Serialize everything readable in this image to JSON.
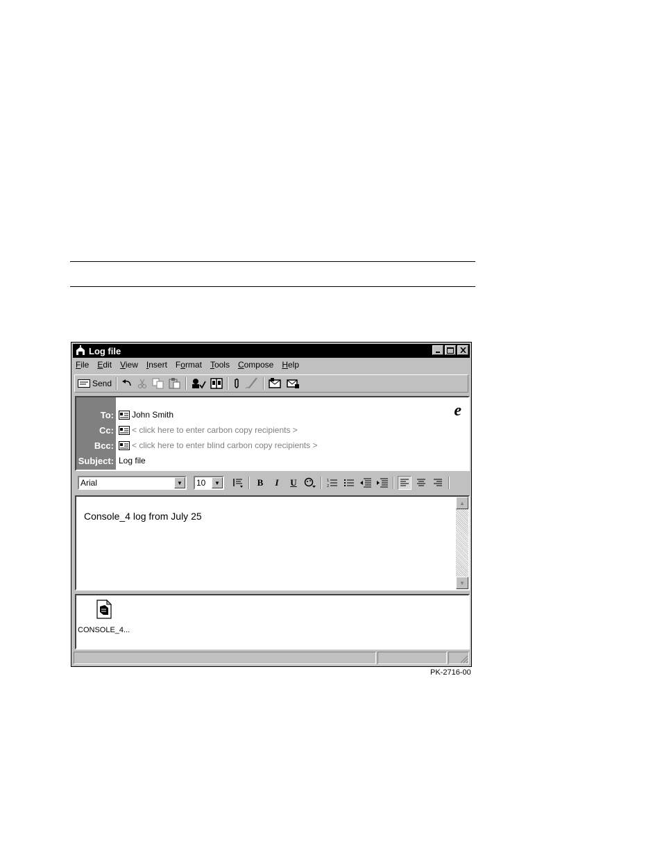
{
  "window": {
    "title": "Log file",
    "buttons": [
      "minimize",
      "maximize",
      "close"
    ]
  },
  "menu": [
    {
      "label": "File",
      "accel": "F",
      "rest": "ile"
    },
    {
      "label": "Edit",
      "accel": "E",
      "rest": "dit"
    },
    {
      "label": "View",
      "accel": "V",
      "rest": "iew"
    },
    {
      "label": "Insert",
      "accel": "I",
      "rest": "nsert"
    },
    {
      "label": "Format",
      "pre": "F",
      "accel": "o",
      "rest": "rmat"
    },
    {
      "label": "Tools",
      "accel": "T",
      "rest": "ools"
    },
    {
      "label": "Compose",
      "accel": "C",
      "rest": "ompose"
    },
    {
      "label": "Help",
      "accel": "H",
      "rest": "elp"
    }
  ],
  "toolbar": {
    "send_label": "Send",
    "icons": [
      "send-icon",
      "undo-icon",
      "cut-icon",
      "copy-icon",
      "paste-icon",
      "check-names-icon",
      "address-book-icon",
      "attach-icon",
      "signature-icon",
      "digitally-sign-icon",
      "encrypt-icon"
    ]
  },
  "header": {
    "to_label": "To:",
    "to_value": "John Smith",
    "cc_label": "Cc:",
    "cc_placeholder": "< click here to enter carbon copy recipients >",
    "bcc_label": "Bcc:",
    "bcc_placeholder": "< click here to enter blind carbon copy recipients >",
    "subject_label": "Subject:",
    "subject_value": "Log file"
  },
  "format_bar": {
    "font_value": "Arial",
    "size_value": "10"
  },
  "message": {
    "body_text": "Console_4 log from July 25"
  },
  "attachments": [
    {
      "name": "CONSOLE_4..."
    }
  ],
  "figure_caption": "PK-2716-00"
}
